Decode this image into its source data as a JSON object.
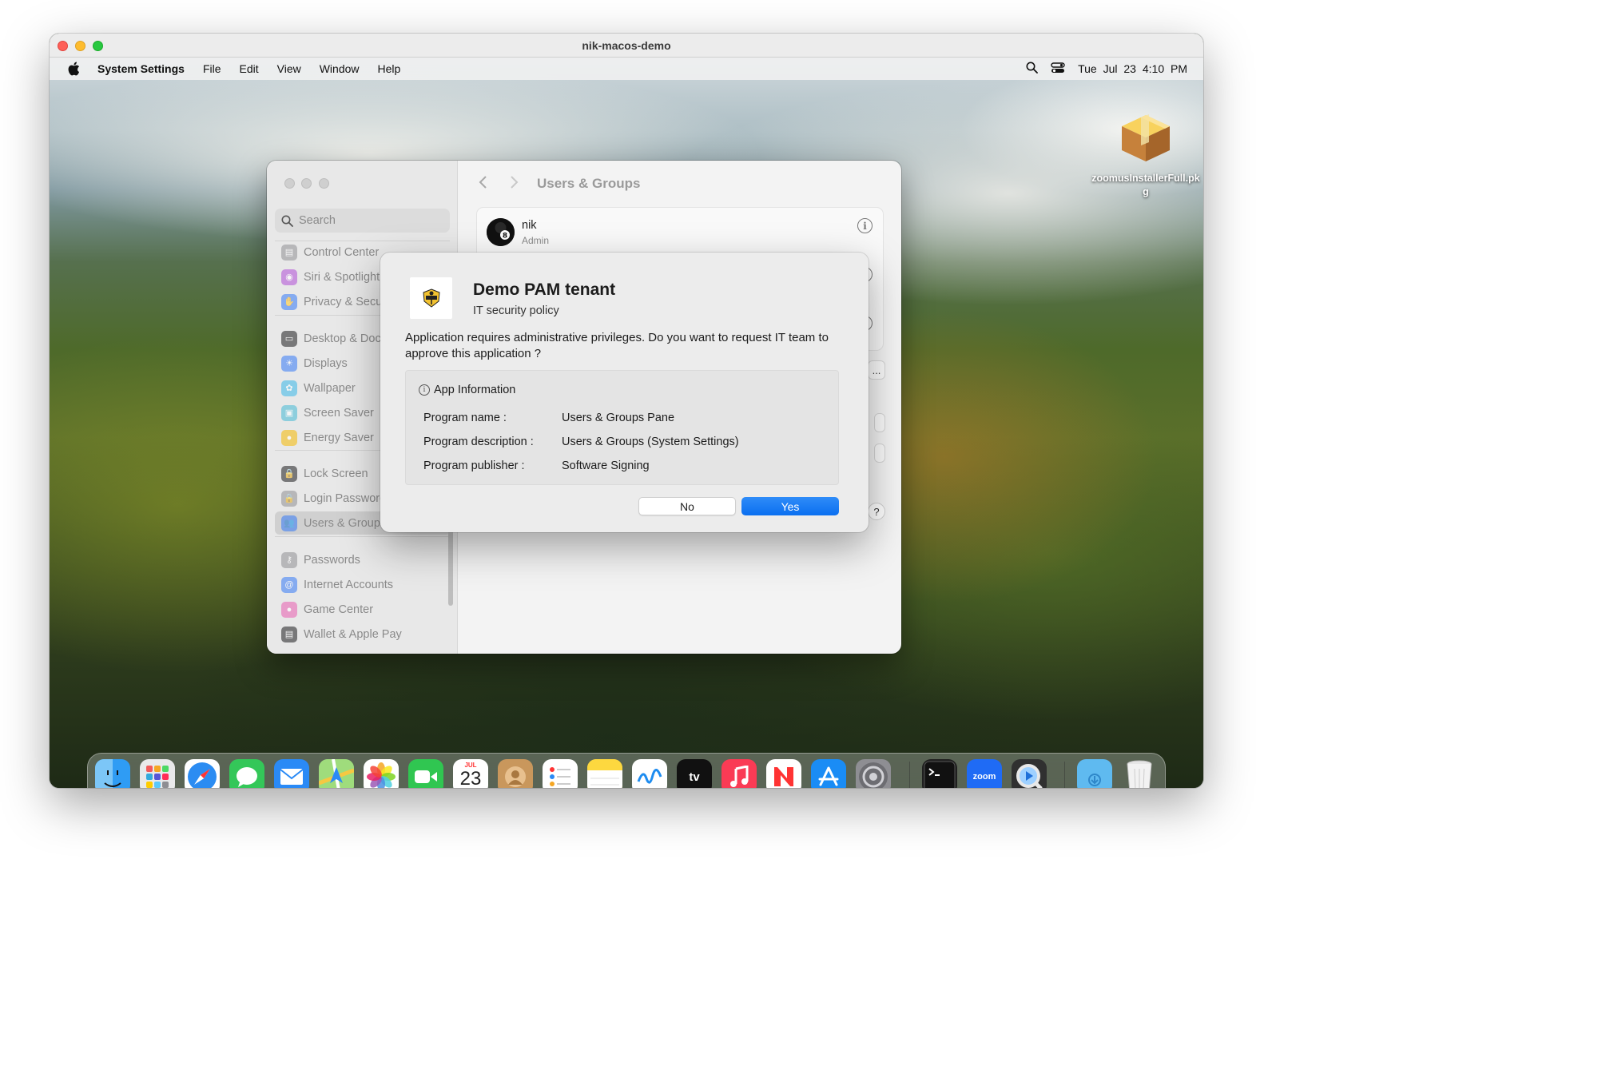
{
  "vm": {
    "title": "nik-macos-demo"
  },
  "menubar": {
    "app_name": "System Settings",
    "items": [
      "File",
      "Edit",
      "View",
      "Window",
      "Help"
    ],
    "clock": "Tue Jul 23  4:10 PM"
  },
  "desktop_file": {
    "label": "zoomusInstallerFull.pkg",
    "icon": "package-icon"
  },
  "settings": {
    "search_placeholder": "Search",
    "pane_title": "Users & Groups",
    "sidebar": [
      {
        "label": "Control Center",
        "icon": "control-center-icon",
        "color": "#8e8e93"
      },
      {
        "label": "Siri & Spotlight",
        "icon": "siri-icon",
        "color": "#b04cd6"
      },
      {
        "label": "Privacy & Security",
        "icon": "hand-icon",
        "color": "#3478f6"
      },
      {
        "label": "Desktop & Dock",
        "icon": "dock-icon",
        "color": "#1c1c1e"
      },
      {
        "label": "Displays",
        "icon": "sun-icon",
        "color": "#3478f6"
      },
      {
        "label": "Wallpaper",
        "icon": "flower-icon",
        "color": "#38b6e8"
      },
      {
        "label": "Screen Saver",
        "icon": "screen-saver-icon",
        "color": "#42b8d4"
      },
      {
        "label": "Energy Saver",
        "icon": "bulb-icon",
        "color": "#f5b800"
      },
      {
        "label": "Lock Screen",
        "icon": "lock-icon",
        "color": "#1c1c1e"
      },
      {
        "label": "Login Password",
        "icon": "lock-icon",
        "color": "#8e8e93"
      },
      {
        "label": "Users & Groups",
        "icon": "users-icon",
        "color": "#3478f6"
      },
      {
        "label": "Passwords",
        "icon": "key-icon",
        "color": "#8e8e93"
      },
      {
        "label": "Internet Accounts",
        "icon": "at-icon",
        "color": "#3478f6"
      },
      {
        "label": "Game Center",
        "icon": "game-center-icon",
        "color": "#e85bb0"
      },
      {
        "label": "Wallet & Apple Pay",
        "icon": "wallet-icon",
        "color": "#1c1c1e"
      }
    ],
    "user": {
      "name": "nik",
      "role": "Admin"
    },
    "peek_button": "..."
  },
  "dialog": {
    "title": "Demo PAM tenant",
    "subtitle": "IT security policy",
    "message": "Application requires administrative privileges. Do you want to request IT team to approve this application ?",
    "app_info_heading": "App Information",
    "rows": [
      {
        "key": "Program name :",
        "value": "Users & Groups Pane"
      },
      {
        "key": "Program description :",
        "value": "Users & Groups (System Settings)"
      },
      {
        "key": "Program publisher :",
        "value": "Software Signing"
      }
    ],
    "no_label": "No",
    "yes_label": "Yes",
    "accent": "#0a6ff0"
  },
  "dock": {
    "items": [
      {
        "name": "finder-icon",
        "bg": "#2f9cf4",
        "running": true
      },
      {
        "name": "launchpad-icon",
        "bg": "#e9e9ea",
        "running": false
      },
      {
        "name": "safari-icon",
        "bg": "#ffffff",
        "running": false
      },
      {
        "name": "messages-icon",
        "bg": "#34c759",
        "running": false
      },
      {
        "name": "mail-icon",
        "bg": "#2a8af6",
        "running": false
      },
      {
        "name": "maps-icon",
        "bg": "#7fd36b",
        "running": false
      },
      {
        "name": "photos-icon",
        "bg": "#ffffff",
        "running": false
      },
      {
        "name": "facetime-icon",
        "bg": "#30c651",
        "running": false
      },
      {
        "name": "calendar-icon",
        "bg": "#ffffff",
        "running": false,
        "month": "JUL",
        "day": "23"
      },
      {
        "name": "contacts-icon",
        "bg": "#c9975c",
        "running": false
      },
      {
        "name": "reminders-icon",
        "bg": "#ffffff",
        "running": false
      },
      {
        "name": "notes-icon",
        "bg": "#fdd83f",
        "running": false
      },
      {
        "name": "freeform-icon",
        "bg": "#ffffff",
        "running": false
      },
      {
        "name": "apple-tv-icon",
        "bg": "#111111",
        "running": false,
        "text": "tv"
      },
      {
        "name": "music-icon",
        "bg": "#fa3b55",
        "running": false
      },
      {
        "name": "news-icon",
        "bg": "#ffffff",
        "running": false
      },
      {
        "name": "app-store-icon",
        "bg": "#1a8cf5",
        "running": false
      },
      {
        "name": "system-settings-icon",
        "bg": "#8e8e93",
        "running": true
      },
      {
        "name": "terminal-icon",
        "bg": "#1f1f1f",
        "running": true
      },
      {
        "name": "zoom-icon",
        "bg": "#1f6bf5",
        "running": false,
        "text": "zoom"
      },
      {
        "name": "quicktime-icon",
        "bg": "#303030",
        "running": false
      },
      {
        "name": "downloads-folder-icon",
        "bg": "#5fbaf0",
        "running": false
      },
      {
        "name": "trash-icon",
        "bg": "transparent",
        "running": false
      }
    ]
  }
}
